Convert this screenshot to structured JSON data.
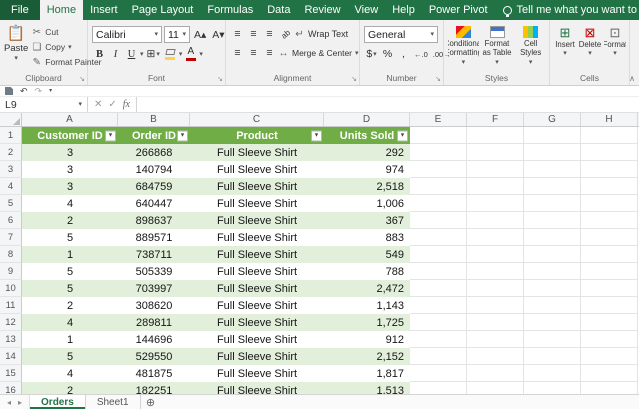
{
  "ribbon": {
    "tabs": [
      {
        "label": "File",
        "type": "file"
      },
      {
        "label": "Home",
        "type": "active"
      },
      {
        "label": "Insert"
      },
      {
        "label": "Page Layout"
      },
      {
        "label": "Formulas"
      },
      {
        "label": "Data"
      },
      {
        "label": "Review"
      },
      {
        "label": "View"
      },
      {
        "label": "Help"
      },
      {
        "label": "Power Pivot"
      }
    ],
    "tell_me": "Tell me what you want to do",
    "groups": {
      "clipboard": {
        "label": "Clipboard",
        "paste": "Paste",
        "cut": "Cut",
        "copy": "Copy",
        "format_painter": "Format Painter"
      },
      "font": {
        "label": "Font",
        "name": "Calibri",
        "size": "11"
      },
      "alignment": {
        "label": "Alignment",
        "wrap_text": "Wrap Text",
        "merge_center": "Merge & Center"
      },
      "number": {
        "label": "Number",
        "format": "General"
      },
      "styles": {
        "label": "Styles",
        "conditional_formatting": "Conditional Formatting",
        "format_as_table": "Format as Table",
        "cell_styles": "Cell Styles"
      },
      "cells": {
        "label": "Cells",
        "insert": "Insert",
        "delete": "Delete",
        "format": "Format"
      }
    }
  },
  "formula_bar": {
    "name_box": "L9",
    "fx": "fx"
  },
  "sheet": {
    "columns": [
      "A",
      "B",
      "C",
      "D",
      "E",
      "F",
      "G",
      "H"
    ],
    "row_numbers": [
      1,
      2,
      3,
      4,
      5,
      6,
      7,
      8,
      9,
      10,
      11,
      12,
      13,
      14,
      15,
      16
    ],
    "table": {
      "headers": [
        "Customer ID",
        "Order ID",
        "Product",
        "Units Sold"
      ],
      "rows": [
        [
          "3",
          "266868",
          "Full Sleeve Shirt",
          "292"
        ],
        [
          "3",
          "140794",
          "Full Sleeve Shirt",
          "974"
        ],
        [
          "3",
          "684759",
          "Full Sleeve Shirt",
          "2,518"
        ],
        [
          "4",
          "640447",
          "Full Sleeve Shirt",
          "1,006"
        ],
        [
          "2",
          "898637",
          "Full Sleeve Shirt",
          "367"
        ],
        [
          "5",
          "889571",
          "Full Sleeve Shirt",
          "883"
        ],
        [
          "1",
          "738711",
          "Full Sleeve Shirt",
          "549"
        ],
        [
          "5",
          "505339",
          "Full Sleeve Shirt",
          "788"
        ],
        [
          "5",
          "703997",
          "Full Sleeve Shirt",
          "2,472"
        ],
        [
          "2",
          "308620",
          "Full Sleeve Shirt",
          "1,143"
        ],
        [
          "4",
          "289811",
          "Full Sleeve Shirt",
          "1,725"
        ],
        [
          "1",
          "144696",
          "Full Sleeve Shirt",
          "912"
        ],
        [
          "5",
          "529550",
          "Full Sleeve Shirt",
          "2,152"
        ],
        [
          "4",
          "481875",
          "Full Sleeve Shirt",
          "1,817"
        ],
        [
          "2",
          "182251",
          "Full Sleeve Shirt",
          "1,513"
        ]
      ]
    }
  },
  "sheet_tabs": {
    "active": "Orders",
    "tabs": [
      "Orders",
      "Sheet1"
    ]
  },
  "icons": {
    "dropdown": "▾",
    "undo": "↶",
    "redo": "↷",
    "cancel": "✕",
    "enter": "✓",
    "cut": "✂",
    "copy": "❏",
    "format_painter": "✎",
    "bold": "B",
    "italic": "I",
    "underline": "U",
    "borders": "⊞",
    "align_lines": "≡",
    "orientation": "ab",
    "wrap": "↵",
    "merge": "↔",
    "accounting": "$",
    "percent": "%",
    "comma": ",",
    "increase_decimal": "←.0",
    "decrease_decimal": ".00→",
    "insert": "⊞",
    "delete": "⊠",
    "format": "⊡",
    "nav_left": "◂",
    "nav_right": "▸",
    "new_sheet": "⊕",
    "grow_font": "A▴",
    "shrink_font": "A▾",
    "collapse_ribbon": "∧",
    "share": "↑"
  },
  "colors": {
    "ribbon_green": "#217346",
    "table_header_green": "#70AD47",
    "band_green": "#E2EFDA"
  }
}
